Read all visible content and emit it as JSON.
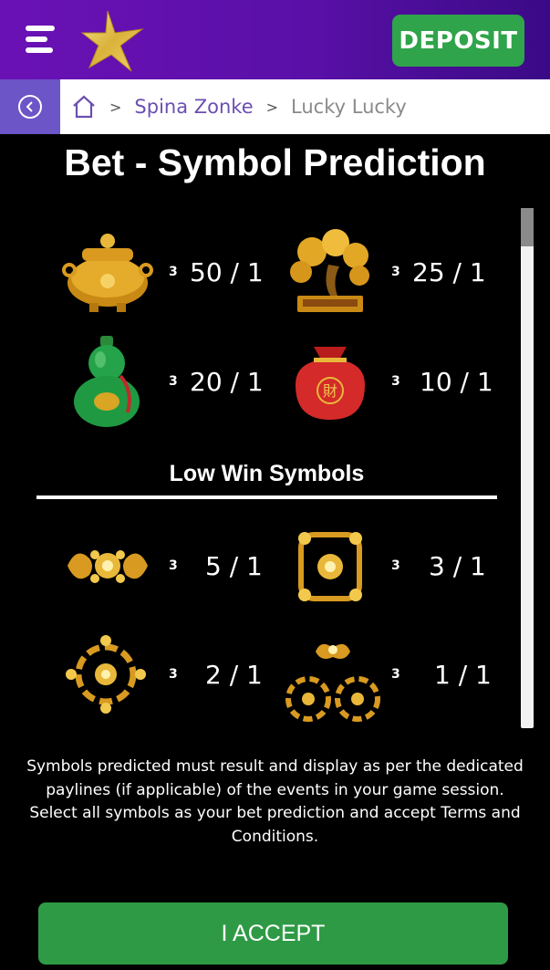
{
  "header": {
    "deposit_label": "DEPOSIT",
    "menu_icon": "hamburger-menu-icon",
    "logo_icon": "gold-star-logo-icon",
    "brand_color": "#6a11b5",
    "accent_green": "#2fa44a"
  },
  "breadcrumb": {
    "back_icon": "chevron-left-circle-icon",
    "home_icon": "home-icon",
    "separator": ">",
    "items": [
      {
        "label": "Spina Zonke"
      },
      {
        "label": "Lucky Lucky"
      }
    ]
  },
  "page": {
    "title": "Bet - Symbol Prediction"
  },
  "high_symbols": [
    {
      "icon": "gold-pot-icon",
      "count": "3",
      "odds": "50 / 1"
    },
    {
      "icon": "money-tree-icon",
      "count": "3",
      "odds": "25 / 1"
    },
    {
      "icon": "jade-gourd-icon",
      "count": "3",
      "odds": "20 / 1"
    },
    {
      "icon": "red-lucky-bag-icon",
      "count": "3",
      "odds": "10 / 1"
    }
  ],
  "low_section": {
    "title": "Low Win Symbols"
  },
  "low_symbols": [
    {
      "icon": "gold-ornament-wide-icon",
      "count": "3",
      "odds": "5 / 1"
    },
    {
      "icon": "gold-ornament-square-icon",
      "count": "3",
      "odds": "3 / 1"
    },
    {
      "icon": "gold-ornament-round-icon",
      "count": "3",
      "odds": "2 / 1"
    },
    {
      "icon": "gold-ornament-cluster-icon",
      "count": "3",
      "odds": "1 / 1"
    }
  ],
  "info": {
    "line1": "Symbols predicted must result and display as per the dedicated paylines (if applicable) of the events in your game session.",
    "line2": "Select all symbols as your bet prediction and accept Terms and Conditions."
  },
  "footer": {
    "accept_label": "I ACCEPT"
  }
}
